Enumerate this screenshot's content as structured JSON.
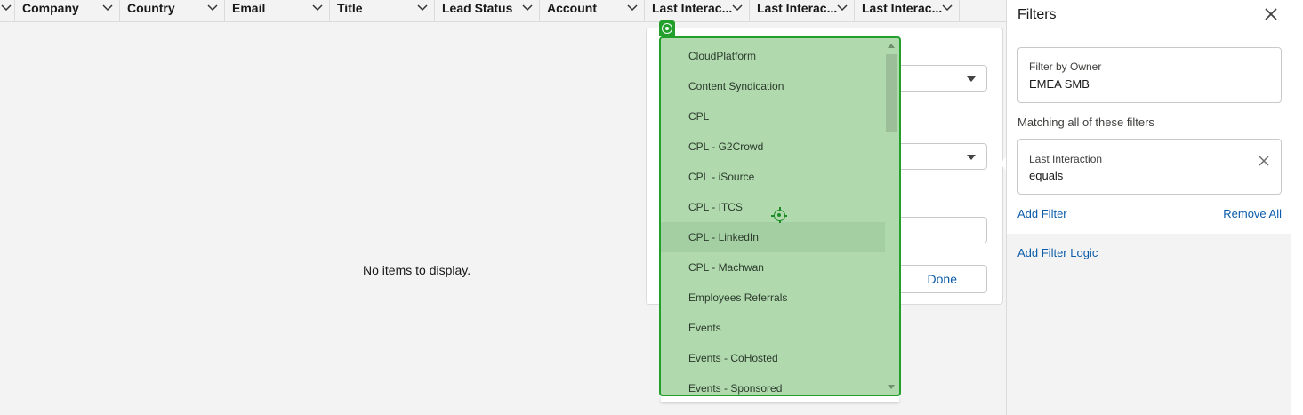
{
  "table": {
    "columns": [
      "Company",
      "Country",
      "Email",
      "Title",
      "Lead Status",
      "Account",
      "Last Interac...",
      "Last Interac...",
      "Last Interac..."
    ],
    "empty_message": "No items to display."
  },
  "popover": {
    "done_label": "Done"
  },
  "dropdown": {
    "options": [
      "CloudPlatform",
      "Content Syndication",
      "CPL",
      "CPL - G2Crowd",
      "CPL - iSource",
      "CPL - ITCS",
      "CPL - LinkedIn",
      "CPL - Machwan",
      "Employees Referrals",
      "Events",
      "Events - CoHosted",
      "Events - Sponsored"
    ],
    "highlighted_index": 6,
    "scroll_position": 0.0
  },
  "filters_panel": {
    "title": "Filters",
    "owner_filter": {
      "label": "Filter by Owner",
      "value": "EMEA SMB"
    },
    "matching_label": "Matching all of these filters",
    "filters": [
      {
        "label": "Last Interaction",
        "value": "equals"
      }
    ],
    "add_filter_label": "Add Filter",
    "remove_all_label": "Remove All",
    "add_filter_logic_label": "Add Filter Logic"
  },
  "colors": {
    "link": "#0b5cab",
    "dropdown_bg": "#b0d9ae",
    "dropdown_border": "#22a02b"
  }
}
